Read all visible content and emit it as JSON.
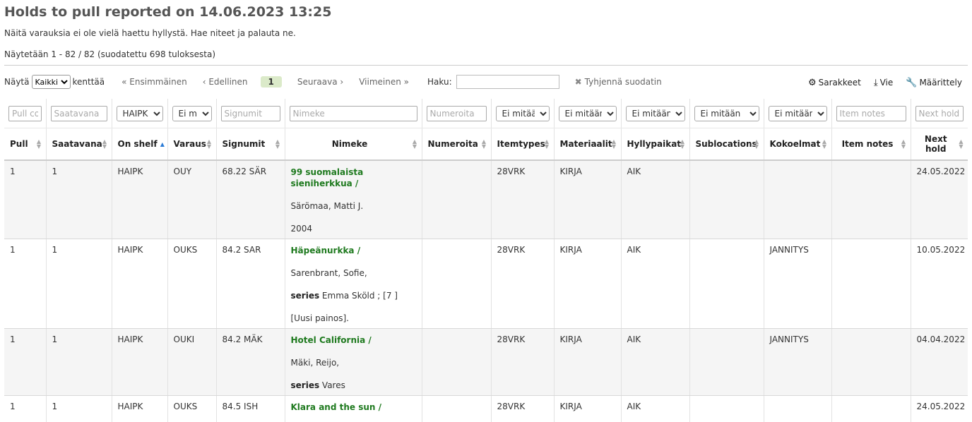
{
  "page": {
    "title": "Holds to pull reported on 14.06.2023 13:25",
    "description": "Näitä varauksia ei ole vielä haettu hyllystä. Hae niteet ja palauta ne.",
    "summary": "Näytetään 1 - 82 / 82 (suodatettu 698 tuloksesta)"
  },
  "pager": {
    "show_label": "Näytä",
    "show_value": "Kaikki",
    "fields_label": "kenttää",
    "first": "« Ensimmäinen",
    "prev": "‹ Edellinen",
    "current": "1",
    "next": "Seuraava ›",
    "last": "Viimeinen »",
    "search_label": "Haku:",
    "search_value": "",
    "clear_label": "Tyhjennä suodatin"
  },
  "tools": {
    "columns": "Sarakkeet",
    "export": "Vie",
    "configure": "Määrittely"
  },
  "filters": {
    "pull": "Pull co",
    "saatavana": "Saatavana",
    "on_shelf": "HAIPK",
    "varaus": "Ei mitä",
    "signumit": "Signumit",
    "nimeke": "Nimeke",
    "numeroita": "Numeroita",
    "itemtypes": "Ei mitää",
    "materiaalit": "Ei mitään",
    "hyllypaikat": "Ei mitään",
    "sublocations": "Ei mitään",
    "kokoelmat": "Ei mitään",
    "item_notes": "Item notes",
    "next_hold": "Next hold"
  },
  "headers": {
    "pull": "Pull",
    "saatavana": "Saatavana",
    "on_shelf": "On shelf",
    "varaus": "Varaus",
    "signumit": "Signumit",
    "nimeke": "Nimeke",
    "numeroita": "Numeroita",
    "itemtypes": "Itemtypes",
    "materiaalit": "Materiaalit",
    "hyllypaikat": "Hyllypaikat",
    "sublocations": "Sublocations",
    "kokoelmat": "Kokoelmat",
    "item_notes": "Item notes",
    "next_hold": "Next hold"
  },
  "rows": [
    {
      "pull": "1",
      "saatavana": "1",
      "on_shelf": "HAIPK",
      "varaus": "OUY",
      "signumit": "68.22 SÄR",
      "title": "99 suomalaista sieniherkkua /",
      "author": "Särömaa, Matti J.",
      "series_label": "",
      "series": "",
      "extra": "2004",
      "numeroita": "",
      "itemtypes": "28VRK",
      "materiaalit": "KIRJA",
      "hyllypaikat": "AIK",
      "sublocations": "",
      "kokoelmat": "",
      "item_notes": "",
      "next_hold": "24.05.2022"
    },
    {
      "pull": "1",
      "saatavana": "1",
      "on_shelf": "HAIPK",
      "varaus": "OUKS",
      "signumit": "84.2 SAR",
      "title": "Häpeänurkka /",
      "author": "Sarenbrant, Sofie,",
      "series_label": "series",
      "series": "Emma Sköld ; [7 ]",
      "extra": "[Uusi painos].",
      "numeroita": "",
      "itemtypes": "28VRK",
      "materiaalit": "KIRJA",
      "hyllypaikat": "AIK",
      "sublocations": "",
      "kokoelmat": "JANNITYS",
      "item_notes": "",
      "next_hold": "10.05.2022"
    },
    {
      "pull": "1",
      "saatavana": "1",
      "on_shelf": "HAIPK",
      "varaus": "OUKI",
      "signumit": "84.2 MÄK",
      "title": "Hotel California /",
      "author": "Mäki, Reijo,",
      "series_label": "series",
      "series": "Vares",
      "extra": "",
      "numeroita": "",
      "itemtypes": "28VRK",
      "materiaalit": "KIRJA",
      "hyllypaikat": "AIK",
      "sublocations": "",
      "kokoelmat": "JANNITYS",
      "item_notes": "",
      "next_hold": "04.04.2022"
    },
    {
      "pull": "1",
      "saatavana": "1",
      "on_shelf": "HAIPK",
      "varaus": "OUKS",
      "signumit": "84.5 ISH",
      "title": "Klara and the sun /",
      "author": "",
      "series_label": "",
      "series": "",
      "extra": "",
      "numeroita": "",
      "itemtypes": "28VRK",
      "materiaalit": "KIRJA",
      "hyllypaikat": "AIK",
      "sublocations": "",
      "kokoelmat": "",
      "item_notes": "",
      "next_hold": "24.05.2022"
    }
  ]
}
